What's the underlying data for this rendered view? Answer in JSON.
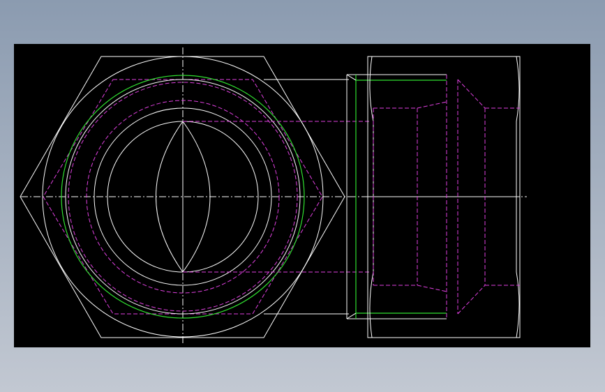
{
  "colors": {
    "background_top": "#8b9bb0",
    "background_bottom": "#c2c8d2",
    "canvas": "#000000",
    "visible_edge": "#ffffff",
    "hidden_edge": "#e040e0",
    "thread": "#30e030"
  },
  "views": [
    {
      "name": "front-view-hex-nut"
    },
    {
      "name": "side-view-hex-nut"
    }
  ]
}
